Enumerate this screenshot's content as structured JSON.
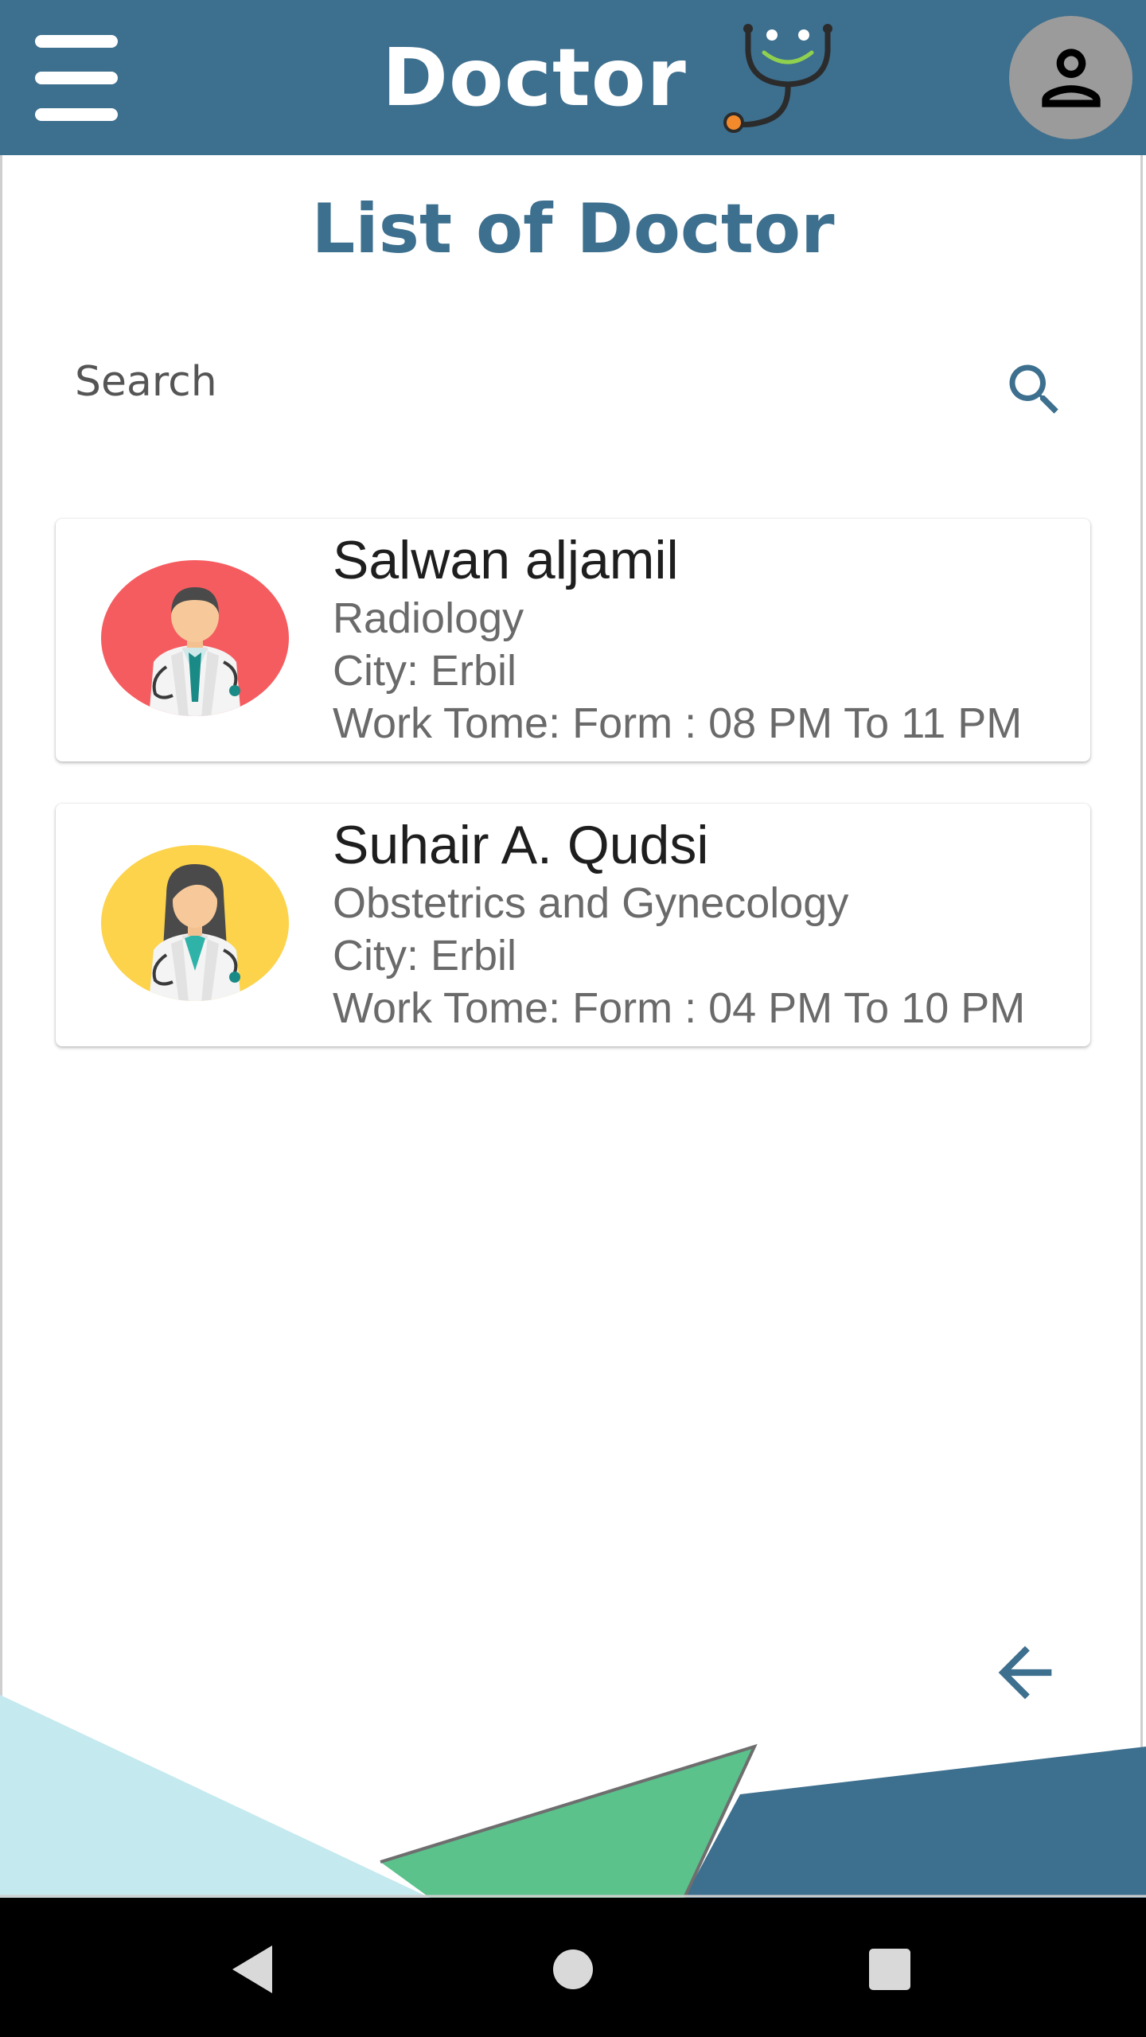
{
  "colors": {
    "primary": "#3d6f8e",
    "accent_green": "#5bc28c",
    "light_blue": "#c4e9ef",
    "doctor1_bg": "#f55c60",
    "doctor2_bg": "#fcd34b"
  },
  "header": {
    "menu_icon": "hamburger-menu-icon",
    "title": "Doctor",
    "logo_icon": "stethoscope-icon",
    "profile_icon": "person-icon"
  },
  "main": {
    "title": "List of Doctor",
    "search": {
      "placeholder": "Search",
      "value": "",
      "icon": "search-icon"
    }
  },
  "doctors": [
    {
      "name": "Salwan aljamil",
      "specialty": "Radiology",
      "city": "City: Erbil",
      "work_time": "Work Tome: Form : 08 PM To 11 PM",
      "avatar_icon": "male-doctor-icon"
    },
    {
      "name": "Suhair A. Qudsi",
      "specialty": "Obstetrics and Gynecology",
      "city": "City: Erbil",
      "work_time": "Work Tome: Form : 04 PM To 10 PM",
      "avatar_icon": "female-doctor-icon"
    }
  ],
  "footer": {
    "back_icon": "arrow-left-icon"
  },
  "system_nav": {
    "back_icon": "triangle-back-icon",
    "home_icon": "circle-home-icon",
    "recents_icon": "square-recents-icon"
  }
}
